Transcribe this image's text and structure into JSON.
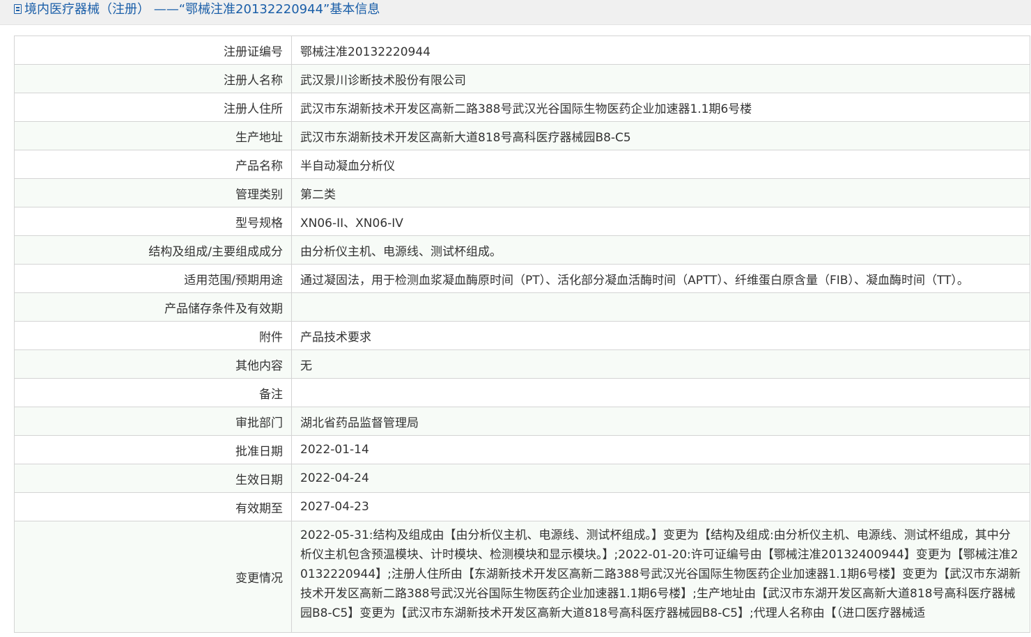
{
  "header": {
    "title": "境内医疗器械（注册） ——“鄂械注准20132220944”基本信息",
    "icon": "document-icon"
  },
  "rows": [
    {
      "label": "注册证编号",
      "value": "鄂械注准20132220944"
    },
    {
      "label": "注册人名称",
      "value": "武汉景川诊断技术股份有限公司"
    },
    {
      "label": "注册人住所",
      "value": "武汉市东湖新技术开发区高新二路388号武汉光谷国际生物医药企业加速器1.1期6号楼"
    },
    {
      "label": "生产地址",
      "value": "武汉市东湖新技术开发区高新大道818号高科医疗器械园B8-C5"
    },
    {
      "label": "产品名称",
      "value": "半自动凝血分析仪"
    },
    {
      "label": "管理类别",
      "value": "第二类"
    },
    {
      "label": "型号规格",
      "value": "XN06-II、XN06-IV"
    },
    {
      "label": "结构及组成/主要组成成分",
      "value": "由分析仪主机、电源线、测试杯组成。"
    },
    {
      "label": "适用范围/预期用途",
      "value": "通过凝固法，用于检测血浆凝血酶原时间（PT）、活化部分凝血活酶时间（APTT）、纤维蛋白原含量（FIB）、凝血酶时间（TT）。"
    },
    {
      "label": "产品储存条件及有效期",
      "value": ""
    },
    {
      "label": "附件",
      "value": "产品技术要求"
    },
    {
      "label": "其他内容",
      "value": "无"
    },
    {
      "label": "备注",
      "value": ""
    },
    {
      "label": "审批部门",
      "value": "湖北省药品监督管理局"
    },
    {
      "label": "批准日期",
      "value": "2022-01-14"
    },
    {
      "label": "生效日期",
      "value": "2022-04-24"
    },
    {
      "label": "有效期至",
      "value": "2027-04-23"
    },
    {
      "label": "变更情况",
      "value": "2022-05-31:结构及组成由【由分析仪主机、电源线、测试杯组成。】变更为【结构及组成:由分析仪主机、电源线、测试杯组成，其中分析仪主机包含预温模块、计时模块、检测模块和显示模块。】;2022-01-20:许可证编号由【鄂械注准20132400944】变更为【鄂械注准20132220944】;注册人住所由【东湖新技术开发区高新二路388号武汉光谷国际生物医药企业加速器1.1期6号楼】变更为【武汉市东湖新技术开发区高新二路388号武汉光谷国际生物医药企业加速器1.1期6号楼】;生产地址由【武汉市东湖开发区高新大道818号高科医疗器械园B8-C5】变更为【武汉市东湖新技术开发区高新大道818号高科医疗器械园B8-C5】;代理人名称由【（进口医疗器械适"
    }
  ]
}
